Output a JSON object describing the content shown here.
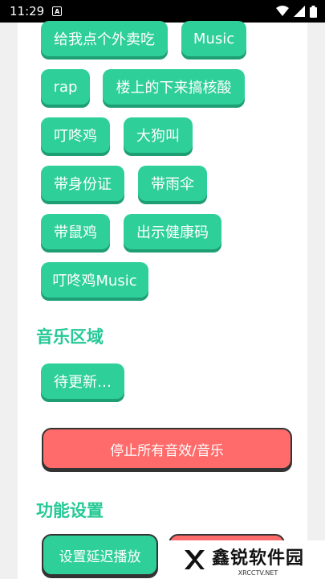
{
  "status": {
    "time": "11:29",
    "a_badge": "A"
  },
  "chips": [
    {
      "label": "给我点个外卖吃"
    },
    {
      "label": "Music"
    },
    {
      "label": "rap"
    },
    {
      "label": "楼上的下来搞核酸"
    },
    {
      "label": "叮咚鸡"
    },
    {
      "label": "大狗叫"
    },
    {
      "label": "带身份证"
    },
    {
      "label": "带雨伞"
    },
    {
      "label": "带鼠鸡"
    },
    {
      "label": "出示健康码"
    },
    {
      "label": "叮咚鸡Music"
    }
  ],
  "music_section": {
    "title": "音乐区域",
    "chip": "待更新…"
  },
  "stop_button": {
    "label": "停止所有音效/音乐"
  },
  "settings_section": {
    "title": "功能设置",
    "delay_button": "设置延迟播放"
  },
  "watermark": {
    "title": "鑫锐软件园",
    "sub": "XRCCTV.NET"
  },
  "colors": {
    "accent": "#2ecf99",
    "danger": "#ff6b6b",
    "title": "#25c995"
  }
}
